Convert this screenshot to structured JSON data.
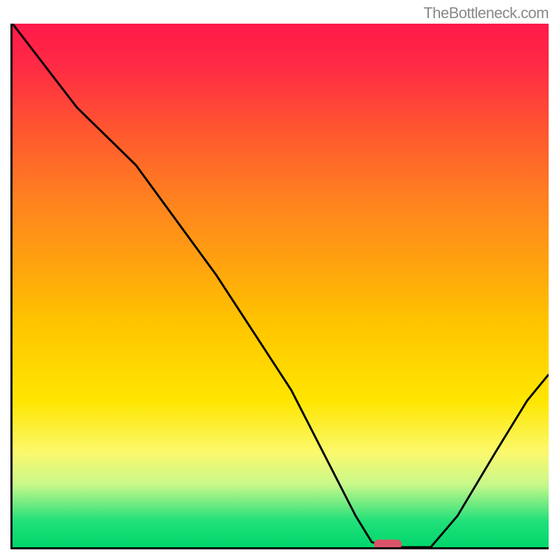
{
  "watermark": "TheBottleneck.com",
  "chart_data": {
    "type": "line",
    "title": "",
    "xlabel": "",
    "ylabel": "",
    "xlim": [
      0,
      100
    ],
    "ylim": [
      0,
      100
    ],
    "x": [
      0,
      12,
      23,
      38,
      52,
      59,
      64,
      67,
      70,
      78,
      83,
      90,
      96,
      100
    ],
    "values": [
      100,
      84,
      73,
      52,
      30,
      16,
      6,
      1,
      0,
      0,
      6,
      18,
      28,
      33
    ],
    "series": [
      {
        "name": "bottleneck-curve",
        "x": [
          0,
          12,
          23,
          38,
          52,
          59,
          64,
          67,
          70,
          78,
          83,
          90,
          96,
          100
        ],
        "values": [
          100,
          84,
          73,
          52,
          30,
          16,
          6,
          1,
          0,
          0,
          6,
          18,
          28,
          33
        ]
      }
    ],
    "marker": {
      "x": 70,
      "y": 0,
      "color": "#d9546b"
    },
    "gradient_stops": [
      {
        "pos": 0,
        "color": "#ff1a4a"
      },
      {
        "pos": 20,
        "color": "#ff5530"
      },
      {
        "pos": 45,
        "color": "#ffa010"
      },
      {
        "pos": 72,
        "color": "#ffe600"
      },
      {
        "pos": 88,
        "color": "#c8f88a"
      },
      {
        "pos": 100,
        "color": "#00d66a"
      }
    ]
  }
}
